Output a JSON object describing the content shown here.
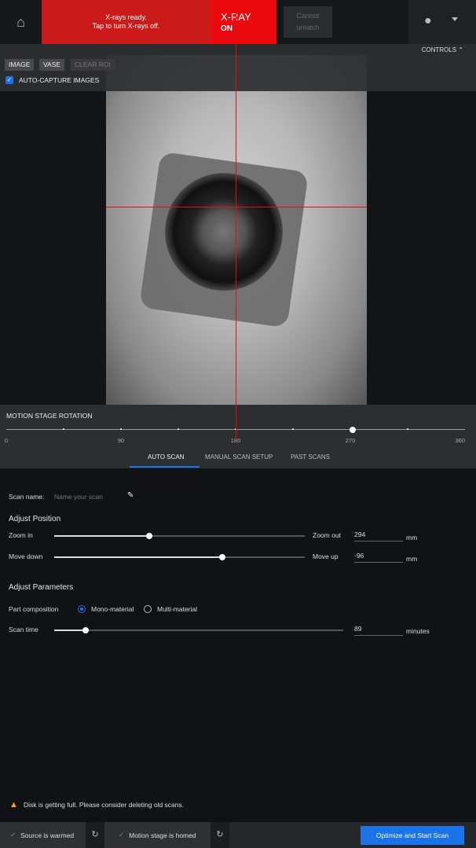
{
  "header": {
    "banner_line1": "X-rays ready.",
    "banner_line2": "Tap to turn X-rays off.",
    "xray_title": "X-RAY",
    "xray_state": "ON",
    "unlatch_line1": "Cannot",
    "unlatch_line2": "unlatch"
  },
  "viewer": {
    "controls_label": "CONTROLS",
    "buttons": [
      "IMAGE",
      "VASE",
      "CLEAR ROI"
    ],
    "auto_capture_label": "AUTO-CAPTURE IMAGES",
    "auto_capture_checked": true
  },
  "rotation": {
    "title": "MOTION STAGE ROTATION",
    "ticks": [
      "0",
      "90",
      "180",
      "270",
      "360"
    ],
    "min": 0,
    "max": 360,
    "value": 272
  },
  "tabs": [
    "AUTO SCAN",
    "MANUAL SCAN SETUP",
    "PAST SCANS"
  ],
  "active_tab": "AUTO SCAN",
  "form": {
    "scan_name_label": "Scan name:",
    "scan_name_placeholder": "Name your scan",
    "adjust_position": "Adjust Position",
    "zoom": {
      "left": "Zoom in",
      "right": "Zoom out",
      "value": "294",
      "unit": "mm",
      "fraction": 0.38
    },
    "move": {
      "left": "Move down",
      "right": "Move up",
      "value": "-96",
      "unit": "mm",
      "fraction": 0.67
    },
    "adjust_parameters": "Adjust Parameters",
    "part_label": "Part composition",
    "options": [
      "Mono-material",
      "Multi-material"
    ],
    "selected": "Mono-material",
    "scan_time": {
      "label": "Scan time",
      "value": "89",
      "unit": "minutes",
      "fraction": 0.11
    }
  },
  "warning": "Disk is getting full. Please consider deleting old scans.",
  "footer": {
    "source": "Source is warmed",
    "stage": "Motion stage is homed",
    "start": "Optimize and Start Scan"
  },
  "colors": {
    "accent": "#1a73e8",
    "xray_red": "#ea0a10",
    "warning": "#f5a623"
  }
}
